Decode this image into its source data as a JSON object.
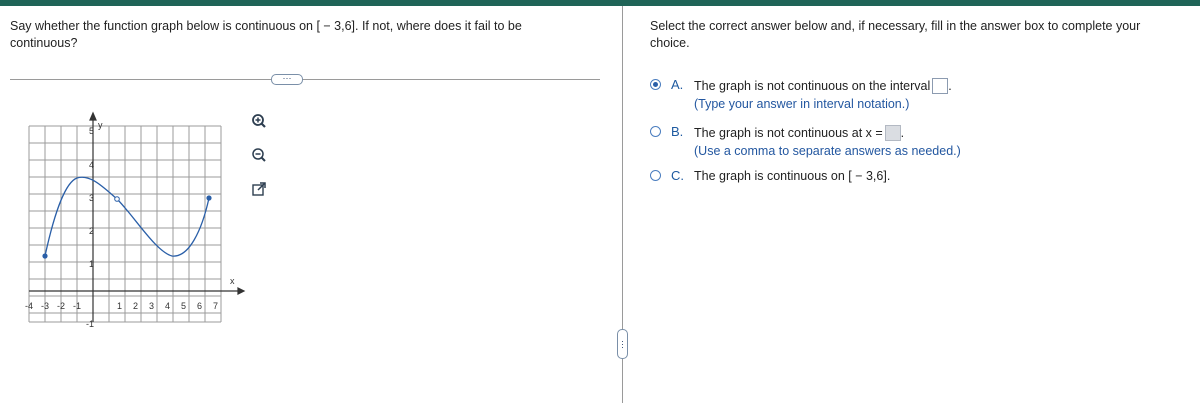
{
  "question": {
    "text": "Say whether the function graph below is continuous on [ − 3,6]. If not, where does it fail to be continuous?"
  },
  "more_pill": "⋯",
  "graph": {
    "x_label": "x",
    "y_label": "y",
    "x_ticks": [
      "-4",
      "-3",
      "-2",
      "-1",
      "1",
      "2",
      "3",
      "4",
      "5",
      "6",
      "7"
    ],
    "y_ticks": [
      "5",
      "4",
      "3",
      "2",
      "1",
      "-1"
    ]
  },
  "tools": [
    "zoom-in-icon",
    "zoom-out-icon",
    "open-external-icon"
  ],
  "answer": {
    "instruction": "Select the correct answer below and, if necessary, fill in the answer box to complete your choice.",
    "options": [
      {
        "letter": "A.",
        "text": "The graph is not continuous on the interval",
        "hint": "(Type your answer in interval notation.)",
        "selected": true
      },
      {
        "letter": "B.",
        "text": "The graph is not continuous at x =",
        "hint": "(Use a comma to separate answers as needed.)",
        "selected": false
      },
      {
        "letter": "C.",
        "text": "The graph is continuous on [ − 3,6].",
        "hint": "",
        "selected": false
      }
    ]
  },
  "colors": {
    "accent": "#1f6457",
    "point": "#2a5fa8",
    "link": "#2357a0"
  }
}
